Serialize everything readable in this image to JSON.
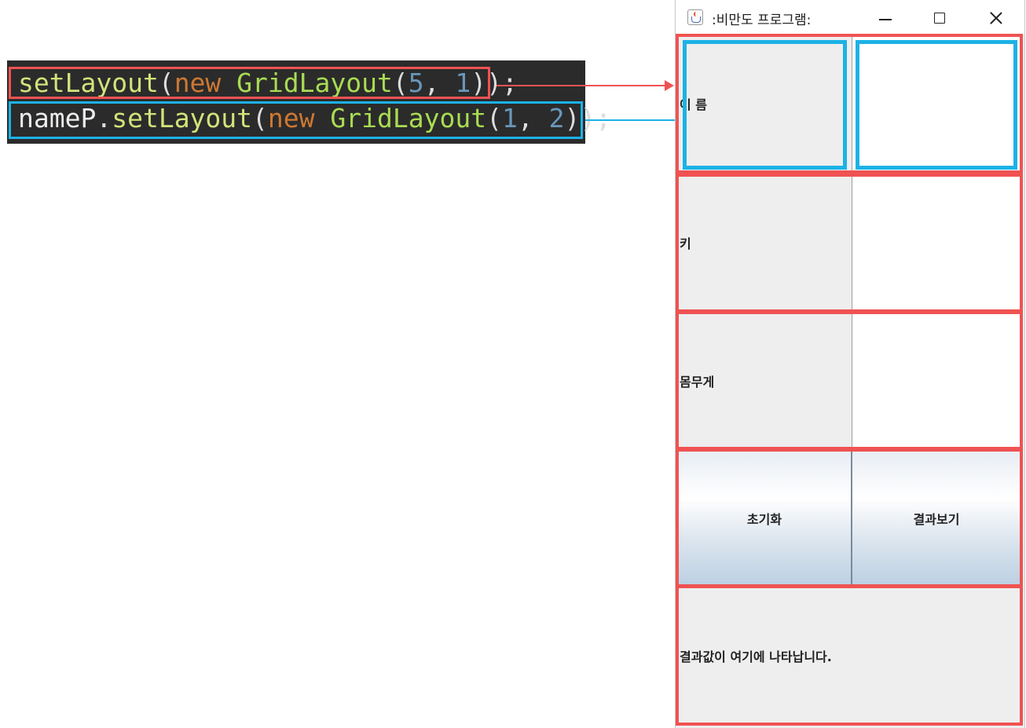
{
  "code": {
    "line1": {
      "method": "setLayout",
      "open": "(",
      "kw": "new",
      "cls": "GridLayout",
      "open2": "(",
      "n1": "5",
      "sep": ", ",
      "n2": "1",
      "close": "));"
    },
    "line2": {
      "obj": "nameP",
      "dot": ".",
      "method": "setLayout",
      "open": "(",
      "kw": "new",
      "cls": "GridLayout",
      "open2": "(",
      "n1": "1",
      "sep": ", ",
      "n2": "2",
      "close": "));"
    }
  },
  "window": {
    "title": ":비만도 프로그램:",
    "rows": {
      "name_label": "이 름",
      "height_label": "키",
      "weight_label": "몸무게",
      "reset_button": "초기화",
      "result_button": "결과보기",
      "result_text": "결과값이 여기에 나타납니다."
    }
  },
  "colors": {
    "red_highlight": "#f05252",
    "blue_highlight": "#1cb2e6",
    "code_background": "#2b2b2b"
  }
}
